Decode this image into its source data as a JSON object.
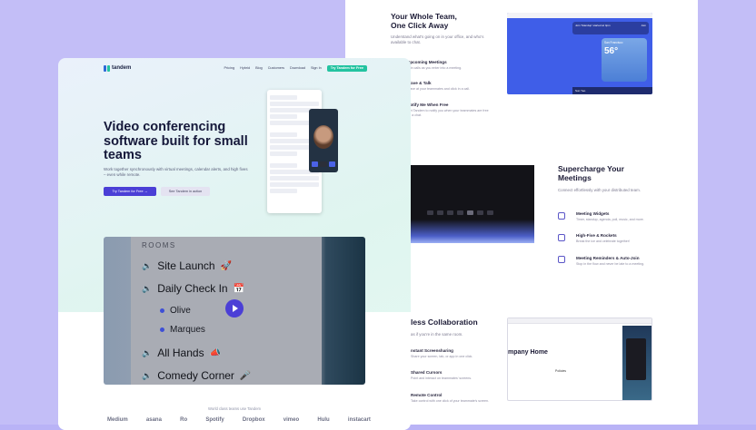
{
  "back": {
    "section1": {
      "title_line1": "Your Whole Team,",
      "title_line2": "One Click Away",
      "subtitle": "Understand what's going on in your office, and who's available to chat.",
      "items": [
        {
          "title": "Upcoming Meetings",
          "desc": "Join calls as you enter into a meeting."
        },
        {
          "title": "Wave & Talk",
          "desc": "Wave at your teammates and click in a call."
        },
        {
          "title": "Notify Me When Free",
          "desc": "Get Tandem to notify you when your teammates are free for a chat."
        }
      ],
      "screenshot": {
        "notif": "Join 'Standup' started at 4pm",
        "join": "Join",
        "temp": "56°",
        "city": "San Francisco",
        "bottom": "Sun Yao"
      }
    },
    "section2": {
      "title_line1": "Supercharge Your",
      "title_line2": "Meetings",
      "subtitle": "Connect effortlessly with your distributed team.",
      "items": [
        {
          "title": "Meeting Widgets",
          "desc": "Timer, standup, agenda, poll, music, and more."
        },
        {
          "title": "High-Five & Rockets",
          "desc": "Break the ice and celebrate together!"
        },
        {
          "title": "Meeting Reminders & Auto-Join",
          "desc": "Stop in the flow and never be late to a meeting."
        }
      ]
    },
    "section3": {
      "title": "less Collaboration",
      "subtitle": "as if you're in the same room.",
      "items": [
        {
          "title": "nstant Screensharing",
          "desc": "Share your screen, tab, or app in one click."
        },
        {
          "title": "Shared Cursors",
          "desc": "Point and interact on teammates' screens."
        },
        {
          "title": "Remote Control",
          "desc": "Take control with one click of your teammate's screen."
        }
      ],
      "screenshot": {
        "heading": "mpany Home",
        "policies": "Policies"
      }
    }
  },
  "front": {
    "logo_text": "tandem",
    "nav": [
      "Pricing",
      "Hybrid",
      "Blog",
      "Customers",
      "Download",
      "Sign In"
    ],
    "nav_cta": "Try Tandem for Free",
    "hero_title": "Video conferencing software built for small teams",
    "hero_subtitle": "Work together synchronously with virtual meetings, calendar alerts, and high fives – even while remote.",
    "btn_primary": "Try Tandem for Free →",
    "btn_secondary": "See Tandem in action",
    "video": {
      "rooms_label": "ROOMS",
      "rooms": [
        {
          "name": "Site Launch",
          "emoji": "🚀"
        },
        {
          "name": "Daily Check In",
          "emoji": "📅"
        },
        {
          "name": "All Hands",
          "emoji": "📣"
        },
        {
          "name": "Comedy Corner",
          "emoji": "🎤"
        }
      ],
      "members": [
        "Olive",
        "Marques"
      ]
    },
    "trust_line": "World class teams use Tandem",
    "logos": [
      "Medium",
      "asana",
      "Ro",
      "Spotify",
      "Dropbox",
      "vimeo",
      "Hulu",
      "instacart"
    ]
  },
  "colors": {
    "accent": "#4b3fd6",
    "teal": "#23c3a0",
    "background": "#b9b3f6"
  }
}
